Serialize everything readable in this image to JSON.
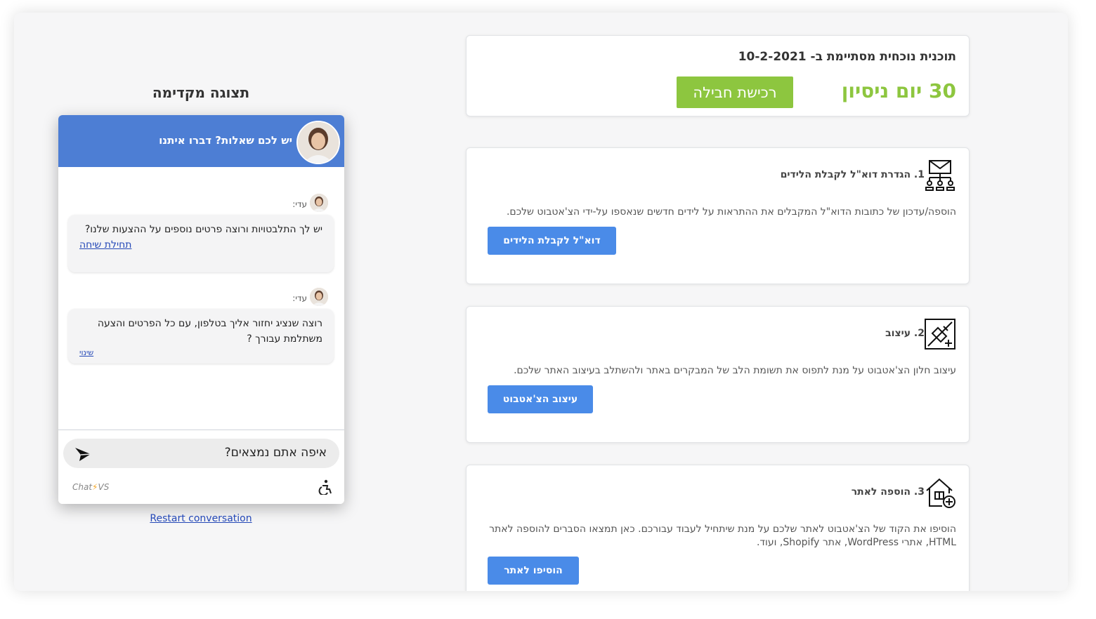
{
  "plan": {
    "title": "תוכנית נוכחית מסתיימת ב- 10-2-2021",
    "trial": "30 יום ניסיון",
    "buy_label": "רכישת חבילה"
  },
  "steps": [
    {
      "heading": "1. הגדרת דוא\"ל לקבלת הלידים",
      "description": "הוספה/עדכון של כתובות הדוא\"ל המקבלים את ההתראות על לידים חדשים שנאספו על-ידי הצ'אטבוט שלכם.",
      "button": "דוא\"ל לקבלת הלידים",
      "icon": "email-network-icon"
    },
    {
      "heading": "2. עיצוב",
      "description": "עיצוב חלון הצ'אטבוט על מנת לתפוס את תשומת הלב של המבקרים באתר ולהשתלב בעיצוב האתר שלכם.",
      "button": "עיצוב הצ'אטבוט",
      "icon": "design-tools-icon"
    },
    {
      "heading": "3. הוספה לאתר",
      "description": "הוסיפו את הקוד של הצ'אטבוט לאתר שלכם על מנת שיתחיל לעבוד עבורכם. כאן תמצאו הסברים להוספה לאתר HTML, אתרי WordPress, אתר Shopify, ועוד.",
      "button": "הוסיפו לאתר",
      "icon": "house-add-icon"
    }
  ],
  "preview": {
    "title": "תצוגה מקדימה",
    "header_text": "יש לכם שאלות? דברו איתנו",
    "messages": [
      {
        "sender": "עדי:",
        "text": "יש לך התלבטויות ורוצה פרטים נוספים על ההצעות שלנו?",
        "link": "תחילת שיחה"
      },
      {
        "sender": "עדי:",
        "text": "רוצה שנציג יחזור אליך בטלפון, עם כל הפרטים והצעה משתלמת עבורך ?",
        "link": "שינוי"
      }
    ],
    "input_value": "איפה אתם נמצאים?",
    "brand_a": "Chat",
    "brand_b": "VS",
    "restart": "Restart conversation"
  },
  "colors": {
    "accent_green": "#8dc63f",
    "button_blue": "#4a8be8",
    "chat_header": "#4d7ed4"
  }
}
